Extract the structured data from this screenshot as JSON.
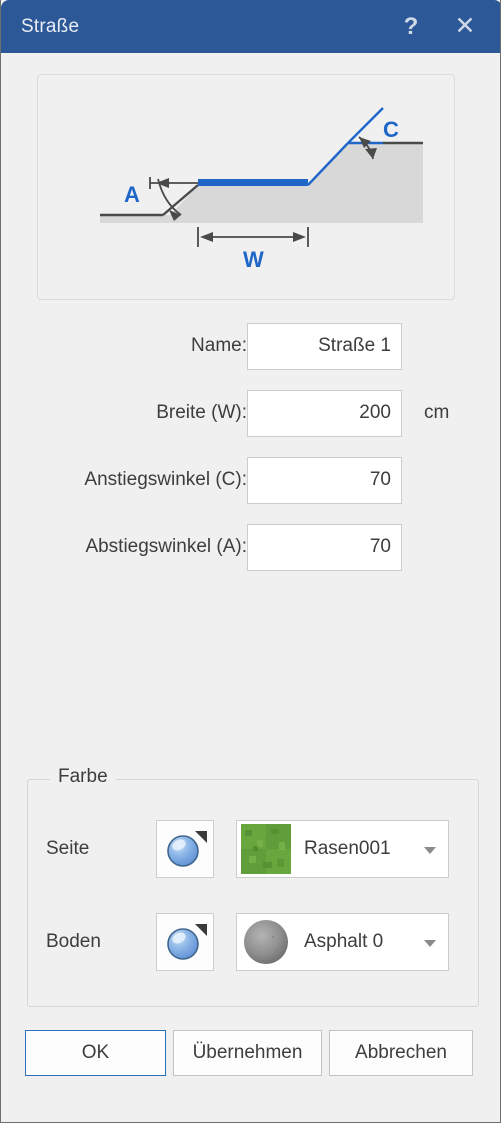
{
  "window": {
    "title": "Straße",
    "help_icon": "question-mark-icon",
    "help_label": "?",
    "close_label": "✕",
    "accent_color": "#2c5898",
    "blue_accent": "#1f66c8"
  },
  "preview": {
    "label_a": "A",
    "label_w": "W",
    "label_c": "C",
    "road_color": "#1f66c8",
    "terrain_color": "#d8d8d8",
    "line_color": "#4a4a4a"
  },
  "form": {
    "rows": [
      {
        "label": "Name:",
        "value": "Straße 1",
        "unit": ""
      },
      {
        "label": "Breite (W):",
        "value": "200",
        "unit": "cm"
      },
      {
        "label": "Anstiegswinkel (C):",
        "value": "70",
        "unit": ""
      },
      {
        "label": "Abstiegswinkel (A):",
        "value": "70",
        "unit": ""
      }
    ]
  },
  "farbe": {
    "legend": "Farbe",
    "rows": [
      {
        "label": "Seite",
        "color_button_icon": "sphere-color-picker-icon",
        "material": "Rasen001",
        "swatch_type": "grass-texture",
        "swatch_color": "#5f9e3a"
      },
      {
        "label": "Boden",
        "color_button_icon": "sphere-color-picker-icon",
        "material": "Asphalt 0",
        "swatch_type": "asphalt-sphere",
        "swatch_color": "#8e8e8e"
      }
    ]
  },
  "buttons": {
    "ok": "OK",
    "apply": "Übernehmen",
    "cancel": "Abbrechen"
  }
}
